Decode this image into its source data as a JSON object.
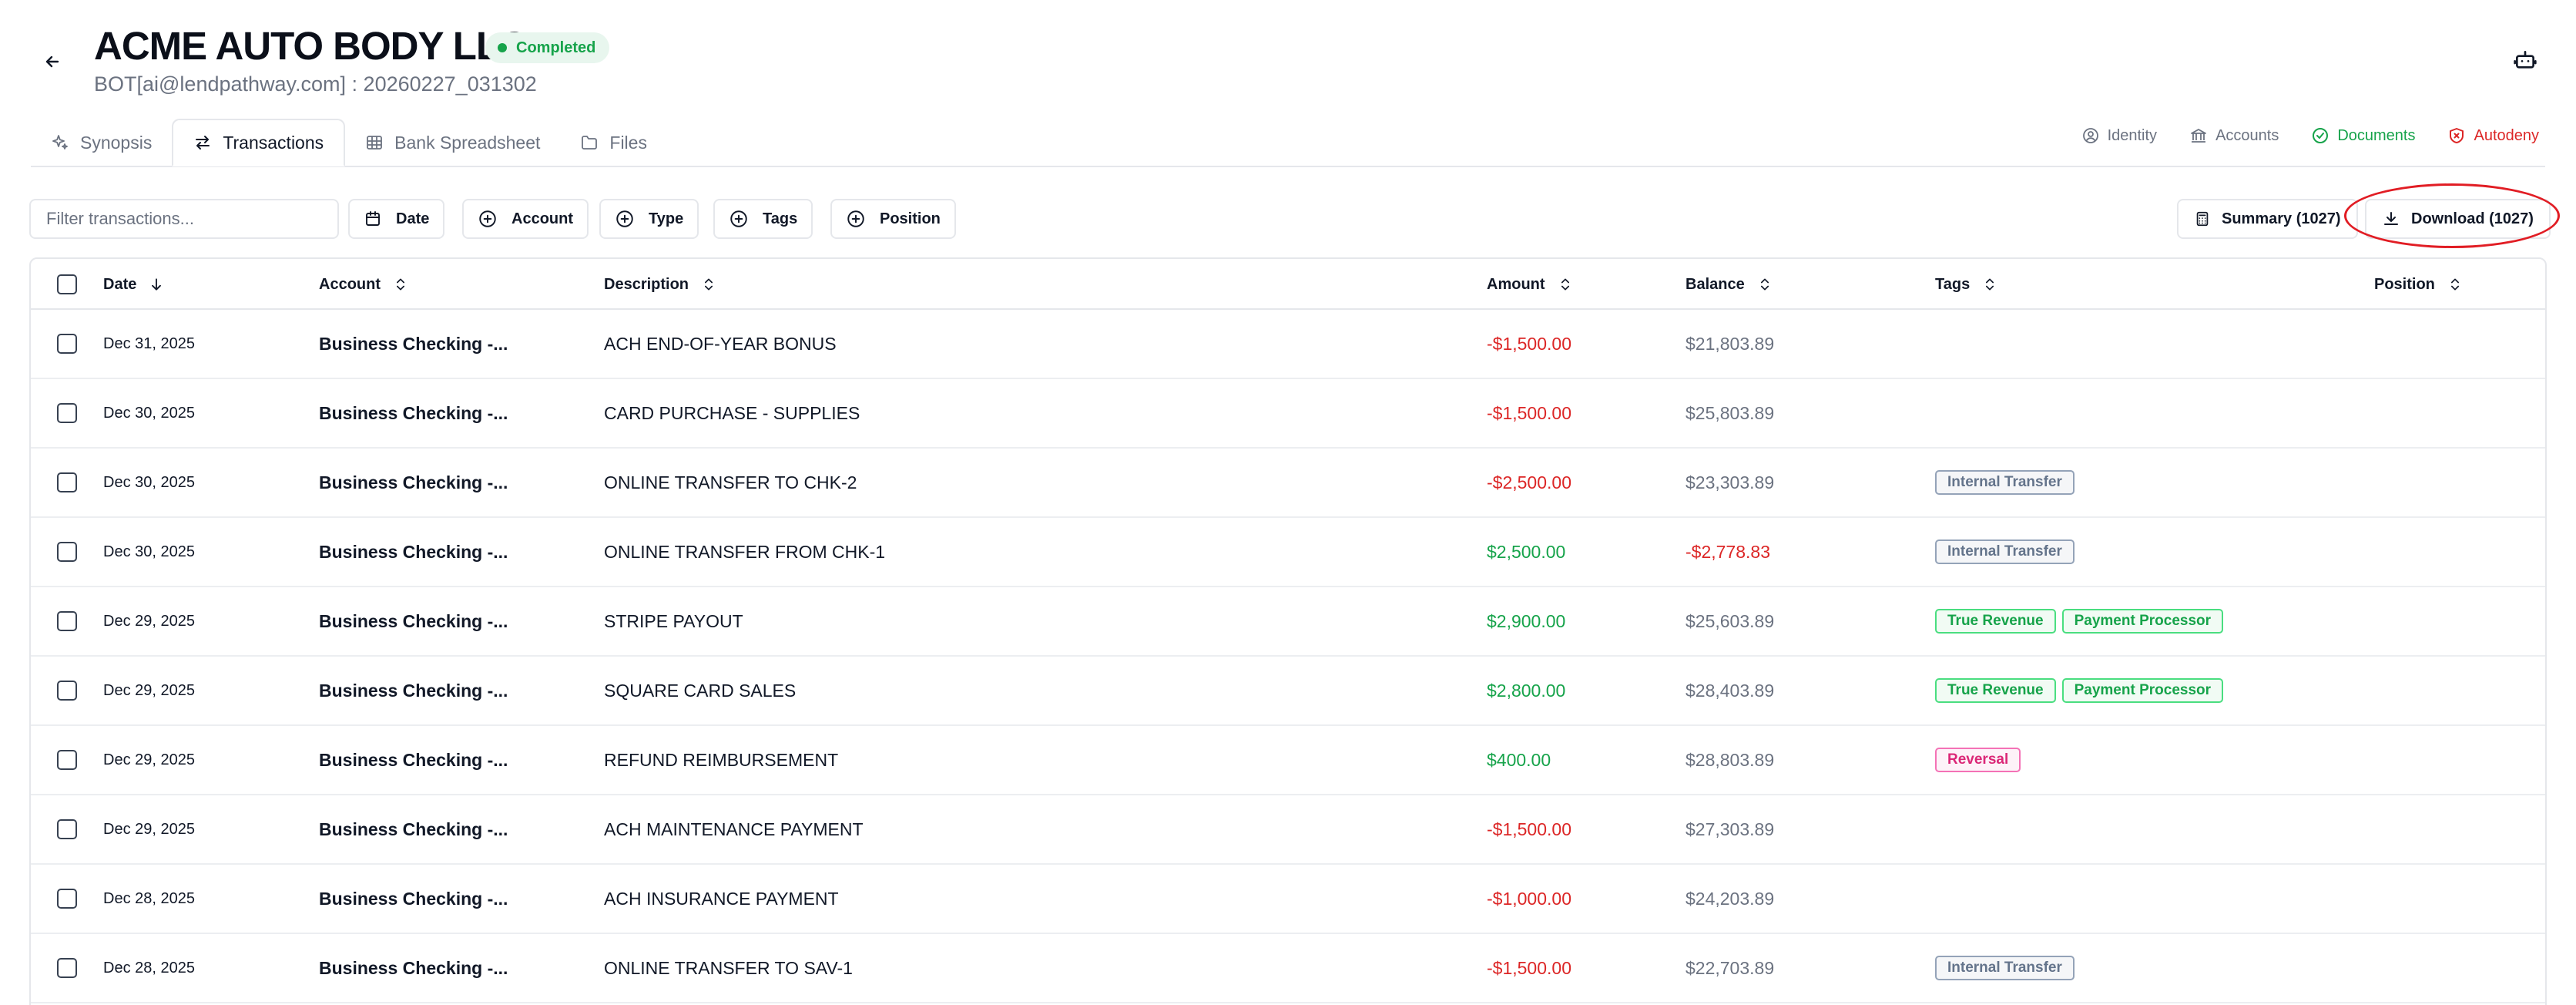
{
  "header": {
    "title": "ACME AUTO BODY LLC",
    "status": "Completed",
    "subtitle": "BOT[ai@lendpathway.com] : 20260227_031302"
  },
  "tabs": [
    {
      "label": "Synopsis",
      "icon": "sparkles-icon",
      "active": false
    },
    {
      "label": "Transactions",
      "icon": "arrows-swap-icon",
      "active": true
    },
    {
      "label": "Bank Spreadsheet",
      "icon": "table-icon",
      "active": false
    },
    {
      "label": "Files",
      "icon": "folder-icon",
      "active": false
    }
  ],
  "status_links": [
    {
      "label": "Identity",
      "icon": "user-circle-icon",
      "color": "#6b7280"
    },
    {
      "label": "Accounts",
      "icon": "bank-icon",
      "color": "#6b7280"
    },
    {
      "label": "Documents",
      "icon": "check-circle-icon",
      "color": "#16a34a"
    },
    {
      "label": "Autodeny",
      "icon": "shield-x-icon",
      "color": "#dc2626"
    }
  ],
  "toolbar": {
    "filter_placeholder": "Filter transactions...",
    "filters": [
      "Date",
      "Account",
      "Type",
      "Tags",
      "Position"
    ],
    "summary_label": "Summary (1027)",
    "download_label": "Download (1027)"
  },
  "table": {
    "columns": [
      "Date",
      "Account",
      "Description",
      "Amount",
      "Balance",
      "Tags",
      "Position"
    ],
    "rows": [
      {
        "date": "Dec 31, 2025",
        "account": "Business Checking -...",
        "description": "ACH END-OF-YEAR BONUS",
        "amount": "-$1,500.00",
        "amount_sign": "neg",
        "balance": "$21,803.89",
        "balance_sign": "grey",
        "tags": []
      },
      {
        "date": "Dec 30, 2025",
        "account": "Business Checking -...",
        "description": "CARD PURCHASE - SUPPLIES",
        "amount": "-$1,500.00",
        "amount_sign": "neg",
        "balance": "$25,803.89",
        "balance_sign": "grey",
        "tags": []
      },
      {
        "date": "Dec 30, 2025",
        "account": "Business Checking -...",
        "description": "ONLINE TRANSFER TO CHK-2",
        "amount": "-$2,500.00",
        "amount_sign": "neg",
        "balance": "$23,303.89",
        "balance_sign": "grey",
        "tags": [
          {
            "label": "Internal Transfer",
            "kind": "internal"
          }
        ]
      },
      {
        "date": "Dec 30, 2025",
        "account": "Business Checking -...",
        "description": "ONLINE TRANSFER FROM CHK-1",
        "amount": "$2,500.00",
        "amount_sign": "pos",
        "balance": "-$2,778.83",
        "balance_sign": "neg",
        "tags": [
          {
            "label": "Internal Transfer",
            "kind": "internal"
          }
        ]
      },
      {
        "date": "Dec 29, 2025",
        "account": "Business Checking -...",
        "description": "STRIPE PAYOUT",
        "amount": "$2,900.00",
        "amount_sign": "pos",
        "balance": "$25,603.89",
        "balance_sign": "grey",
        "tags": [
          {
            "label": "True Revenue",
            "kind": "revenue"
          },
          {
            "label": "Payment Processor",
            "kind": "processor"
          }
        ]
      },
      {
        "date": "Dec 29, 2025",
        "account": "Business Checking -...",
        "description": "SQUARE CARD SALES",
        "amount": "$2,800.00",
        "amount_sign": "pos",
        "balance": "$28,403.89",
        "balance_sign": "grey",
        "tags": [
          {
            "label": "True Revenue",
            "kind": "revenue"
          },
          {
            "label": "Payment Processor",
            "kind": "processor"
          }
        ]
      },
      {
        "date": "Dec 29, 2025",
        "account": "Business Checking -...",
        "description": "REFUND REIMBURSEMENT",
        "amount": "$400.00",
        "amount_sign": "pos",
        "balance": "$28,803.89",
        "balance_sign": "grey",
        "tags": [
          {
            "label": "Reversal",
            "kind": "reversal"
          }
        ]
      },
      {
        "date": "Dec 29, 2025",
        "account": "Business Checking -...",
        "description": "ACH MAINTENANCE PAYMENT",
        "amount": "-$1,500.00",
        "amount_sign": "neg",
        "balance": "$27,303.89",
        "balance_sign": "grey",
        "tags": []
      },
      {
        "date": "Dec 28, 2025",
        "account": "Business Checking -...",
        "description": "ACH INSURANCE PAYMENT",
        "amount": "-$1,000.00",
        "amount_sign": "neg",
        "balance": "$24,203.89",
        "balance_sign": "grey",
        "tags": []
      },
      {
        "date": "Dec 28, 2025",
        "account": "Business Checking -...",
        "description": "ONLINE TRANSFER TO SAV-1",
        "amount": "-$1,500.00",
        "amount_sign": "neg",
        "balance": "$22,703.89",
        "balance_sign": "grey",
        "tags": [
          {
            "label": "Internal Transfer",
            "kind": "internal"
          }
        ]
      }
    ]
  }
}
